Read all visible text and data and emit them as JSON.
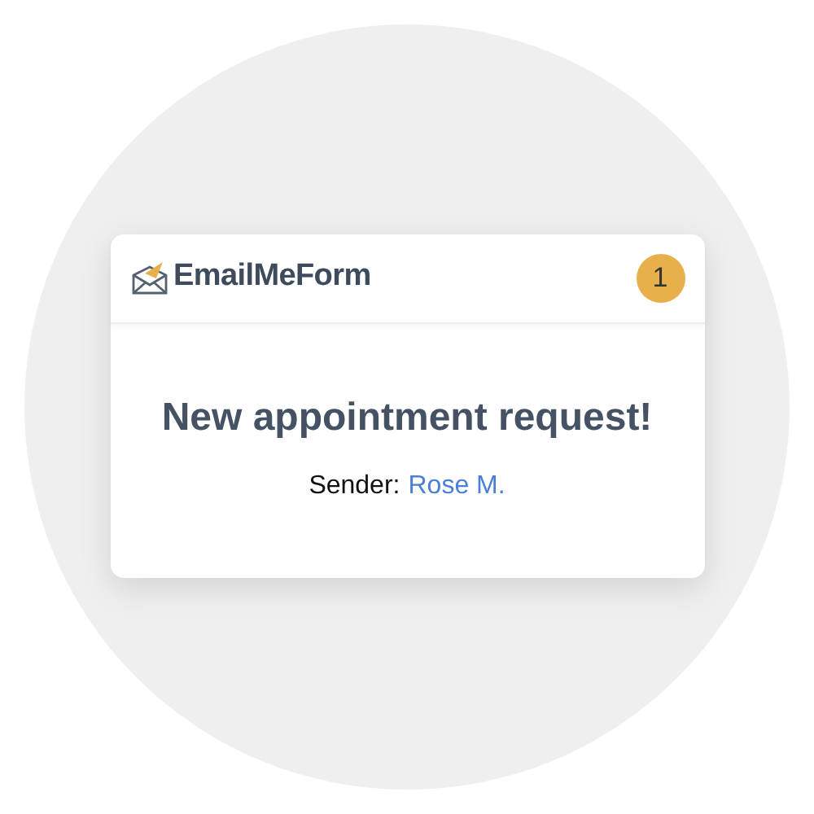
{
  "brand": "EmailMeForm",
  "badge": "1",
  "message": {
    "title": "New appointment request!",
    "sender_label": "Sender:",
    "sender_name": "Rose M."
  }
}
